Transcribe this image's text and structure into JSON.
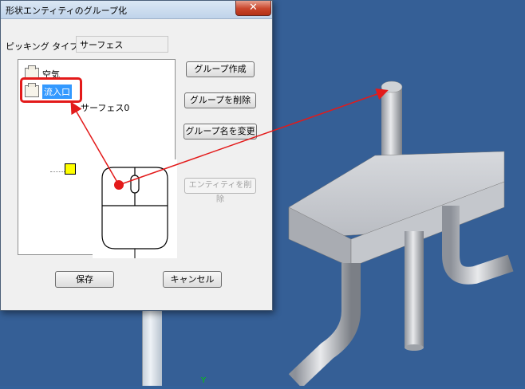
{
  "dialog": {
    "title": "形状エンティティのグループ化",
    "close_glyph": "✕",
    "picking_label": "ピッキング タイプ:",
    "picking_value": "サーフェス"
  },
  "tree": {
    "items": [
      {
        "label": "空気"
      },
      {
        "label": "流入口",
        "selected": true
      },
      {
        "label": "サーフェス0"
      }
    ]
  },
  "buttons": {
    "create_group": "グループ作成",
    "delete_group": "グループを削除",
    "rename_group": "グループ名を変更",
    "delete_entity": "エンティティを削除",
    "save": "保存",
    "cancel": "キャンセル"
  },
  "viewport": {
    "axis_label": "Y",
    "background": "#355f96"
  },
  "colors": {
    "annotation": "#e31a1a",
    "selection": "#3399ff",
    "surface_leaf": "#ffff00"
  },
  "icons": [
    "close-icon",
    "folder-icon",
    "surface-icon",
    "mouse-icon",
    "arrow-icon"
  ]
}
